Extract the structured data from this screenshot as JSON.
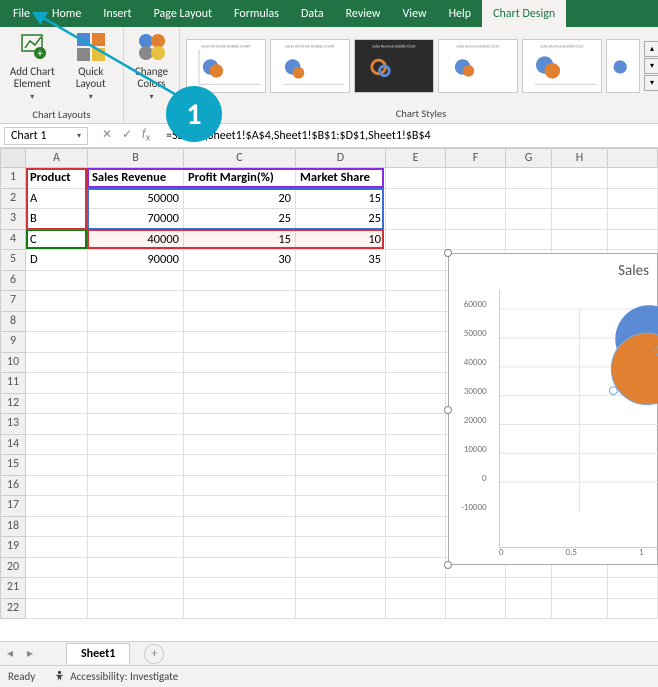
{
  "menubar": {
    "tabs": [
      "File",
      "Home",
      "Insert",
      "Page Layout",
      "Formulas",
      "Data",
      "Review",
      "View",
      "Help",
      "Chart Design"
    ],
    "active": "Chart Design"
  },
  "ribbon": {
    "groups": {
      "chart_layouts": {
        "label": "Chart Layouts",
        "add_chart_element": "Add Chart Element",
        "quick_layout": "Quick Layout"
      },
      "change_colors": {
        "label": "Change Colors"
      },
      "chart_styles": {
        "label": "Chart Styles"
      }
    }
  },
  "namebox": "Chart 1",
  "formula": "=SERIES(Sheet1!$A$4,Sheet1!$B$1:$D$1,Sheet1!$B$4",
  "columns": [
    "A",
    "B",
    "C",
    "D",
    "E",
    "F",
    "G",
    "H"
  ],
  "rows": 22,
  "grid": {
    "r1": {
      "A": "Product",
      "B": "Sales Revenue",
      "C": "Profit Margin(%)",
      "D": "Market Share"
    },
    "r2": {
      "A": "A",
      "B": "50000",
      "C": "20",
      "D": "15"
    },
    "r3": {
      "A": "B",
      "B": "70000",
      "C": "25",
      "D": "25"
    },
    "r4": {
      "A": "C",
      "B": "40000",
      "C": "15",
      "D": "10"
    },
    "r5": {
      "A": "D",
      "B": "90000",
      "C": "30",
      "D": "35"
    }
  },
  "chart": {
    "title": "Sales",
    "y_ticks": [
      "60000",
      "50000",
      "40000",
      "30000",
      "20000",
      "10000",
      "0",
      "-10000"
    ],
    "x_ticks": [
      "0",
      "0.5",
      "1"
    ]
  },
  "chart_data": {
    "type": "bubble",
    "title": "Sales",
    "xlabel": "",
    "ylabel": "",
    "ylim": [
      -10000,
      60000
    ],
    "xlim": [
      0,
      1
    ],
    "x_field": "Profit Margin(%)",
    "y_field": "Sales Revenue",
    "size_field": "Market Share",
    "series": [
      {
        "name": "A",
        "x": 20,
        "y": 50000,
        "size": 15
      },
      {
        "name": "B",
        "x": 25,
        "y": 70000,
        "size": 25
      },
      {
        "name": "C",
        "x": 15,
        "y": 40000,
        "size": 10
      },
      {
        "name": "D",
        "x": 30,
        "y": 90000,
        "size": 35
      }
    ]
  },
  "sheet_tab": "Sheet1",
  "statusbar": {
    "ready": "Ready",
    "accessibility": "Accessibility: Investigate"
  },
  "step_badge": "1"
}
